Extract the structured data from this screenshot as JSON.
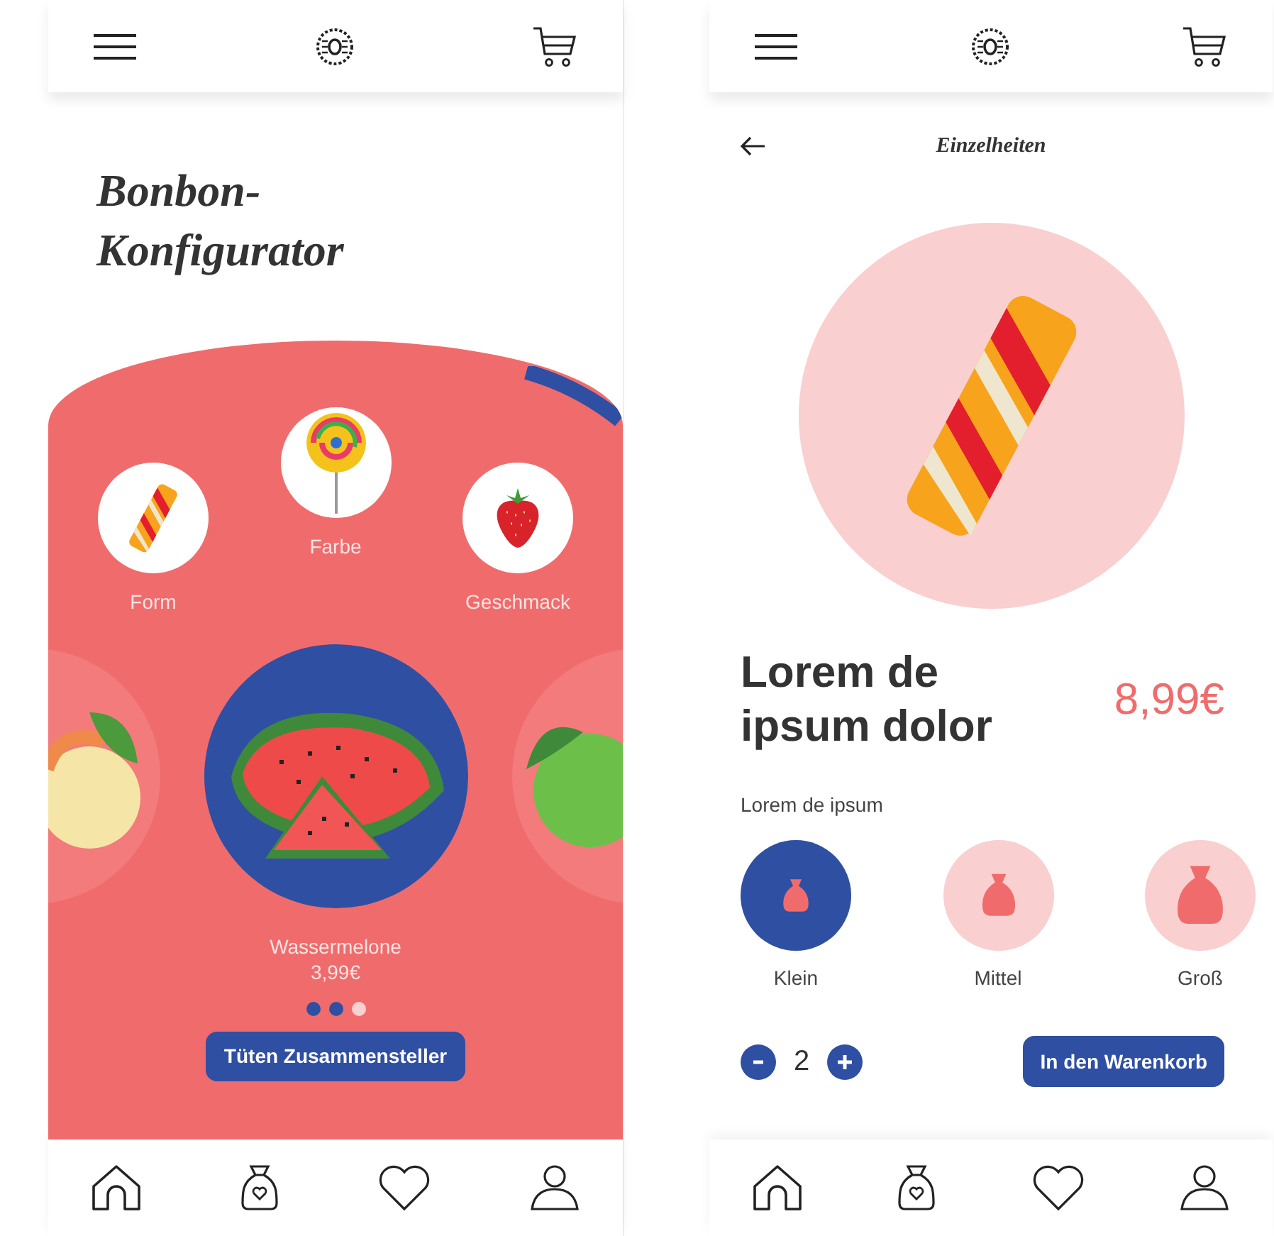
{
  "configurator": {
    "title_lines": [
      "Bonbon-",
      "Konfigurator"
    ],
    "categories": [
      {
        "kind": "twist",
        "label": "Form"
      },
      {
        "kind": "lollipop",
        "label": "Farbe"
      },
      {
        "kind": "strawberry",
        "label": "Geschmack"
      }
    ],
    "carousel": {
      "name": "Wassermelone",
      "price": "3,99€"
    },
    "dots": [
      {
        "selected": true
      },
      {
        "selected": true
      },
      {
        "selected": false
      }
    ],
    "button": "Tüten Zusammensteller"
  },
  "details": {
    "heading": "Einzelheiten",
    "product_name": "Lorem de ipsum dolor",
    "price": "8,99€",
    "option_label": "Lorem de ipsum",
    "sizes": [
      {
        "label": "Klein",
        "selected": true
      },
      {
        "label": "Mittel",
        "selected": false
      },
      {
        "label": "Groß",
        "selected": false
      }
    ],
    "quantity": "2",
    "button": "In den Warenkorb"
  }
}
